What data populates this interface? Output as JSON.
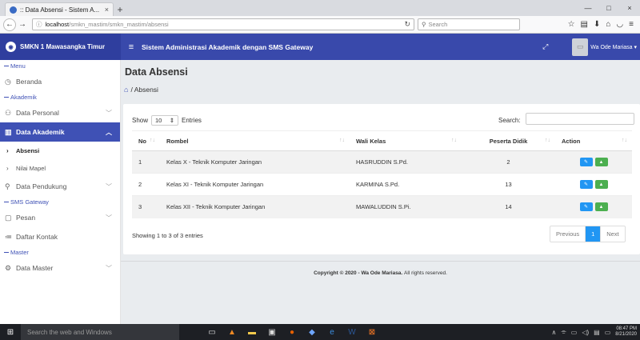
{
  "browser": {
    "tab_title": ":: Data Absensi - Sistem A...",
    "tab_close": "×",
    "new_tab": "+",
    "url_host": "localhost",
    "url_path": "/smkn_mastim/smkn_mastim/absensi",
    "search_placeholder": "Search",
    "win_min": "—",
    "win_max": "□",
    "win_close": "×"
  },
  "header": {
    "brand": "SMKN 1 Mawasangka Timur",
    "system_title": "Sistem Administrasi Akademik dengan SMS Gateway",
    "user_name": "Wa Ode Mariasa ▾"
  },
  "sidebar": {
    "sections": {
      "menu": "Menu",
      "akademik": "Akademik",
      "sms": "SMS Gateway",
      "master": "Master"
    },
    "items": {
      "beranda": "Beranda",
      "data_personal": "Data Personal",
      "data_akademik": "Data Akademik",
      "absensi": "Absensi",
      "nilai_mapel": "Nilai Mapel",
      "data_pendukung": "Data Pendukung",
      "pesan": "Pesan",
      "daftar_kontak": "Daftar Kontak",
      "data_master": "Data Master"
    }
  },
  "page": {
    "title": "Data Absensi",
    "breadcrumb": "/ Absensi"
  },
  "table_controls": {
    "show_label": "Show",
    "length_value": "10",
    "entries_label": "Entries",
    "search_label": "Search:"
  },
  "table": {
    "headers": {
      "no": "No",
      "rombel": "Rombel",
      "wali": "Wali Kelas",
      "peserta": "Peserta Didik",
      "action": "Action"
    },
    "rows": [
      {
        "no": "1",
        "rombel": "Kelas X - Teknik Komputer Jaringan",
        "wali": "HASRUDDIN S.Pd.",
        "peserta": "2"
      },
      {
        "no": "2",
        "rombel": "Kelas XI - Teknik Komputer Jaringan",
        "wali": "KARMINA S.Pd.",
        "peserta": "13"
      },
      {
        "no": "3",
        "rombel": "Kelas XII - Teknik Komputer Jaringan",
        "wali": "MAWALUDDIN S.Pi.",
        "peserta": "14"
      }
    ]
  },
  "pagination": {
    "info": "Showing 1 to 3 of 3 entries",
    "previous": "Previous",
    "current": "1",
    "next": "Next"
  },
  "footer": {
    "prefix": "Copyright © 2020 -",
    "author": "Wa Ode Mariasa.",
    "suffix": "All rights reserved."
  },
  "taskbar": {
    "search_placeholder": "Search the web and Windows",
    "time": "08:47 PM",
    "date": "8/21/2020"
  },
  "colors": {
    "primary": "#3f51b5",
    "topbar": "#3949ab",
    "edit_button": "#2196f3",
    "detail_button": "#4caf50"
  }
}
